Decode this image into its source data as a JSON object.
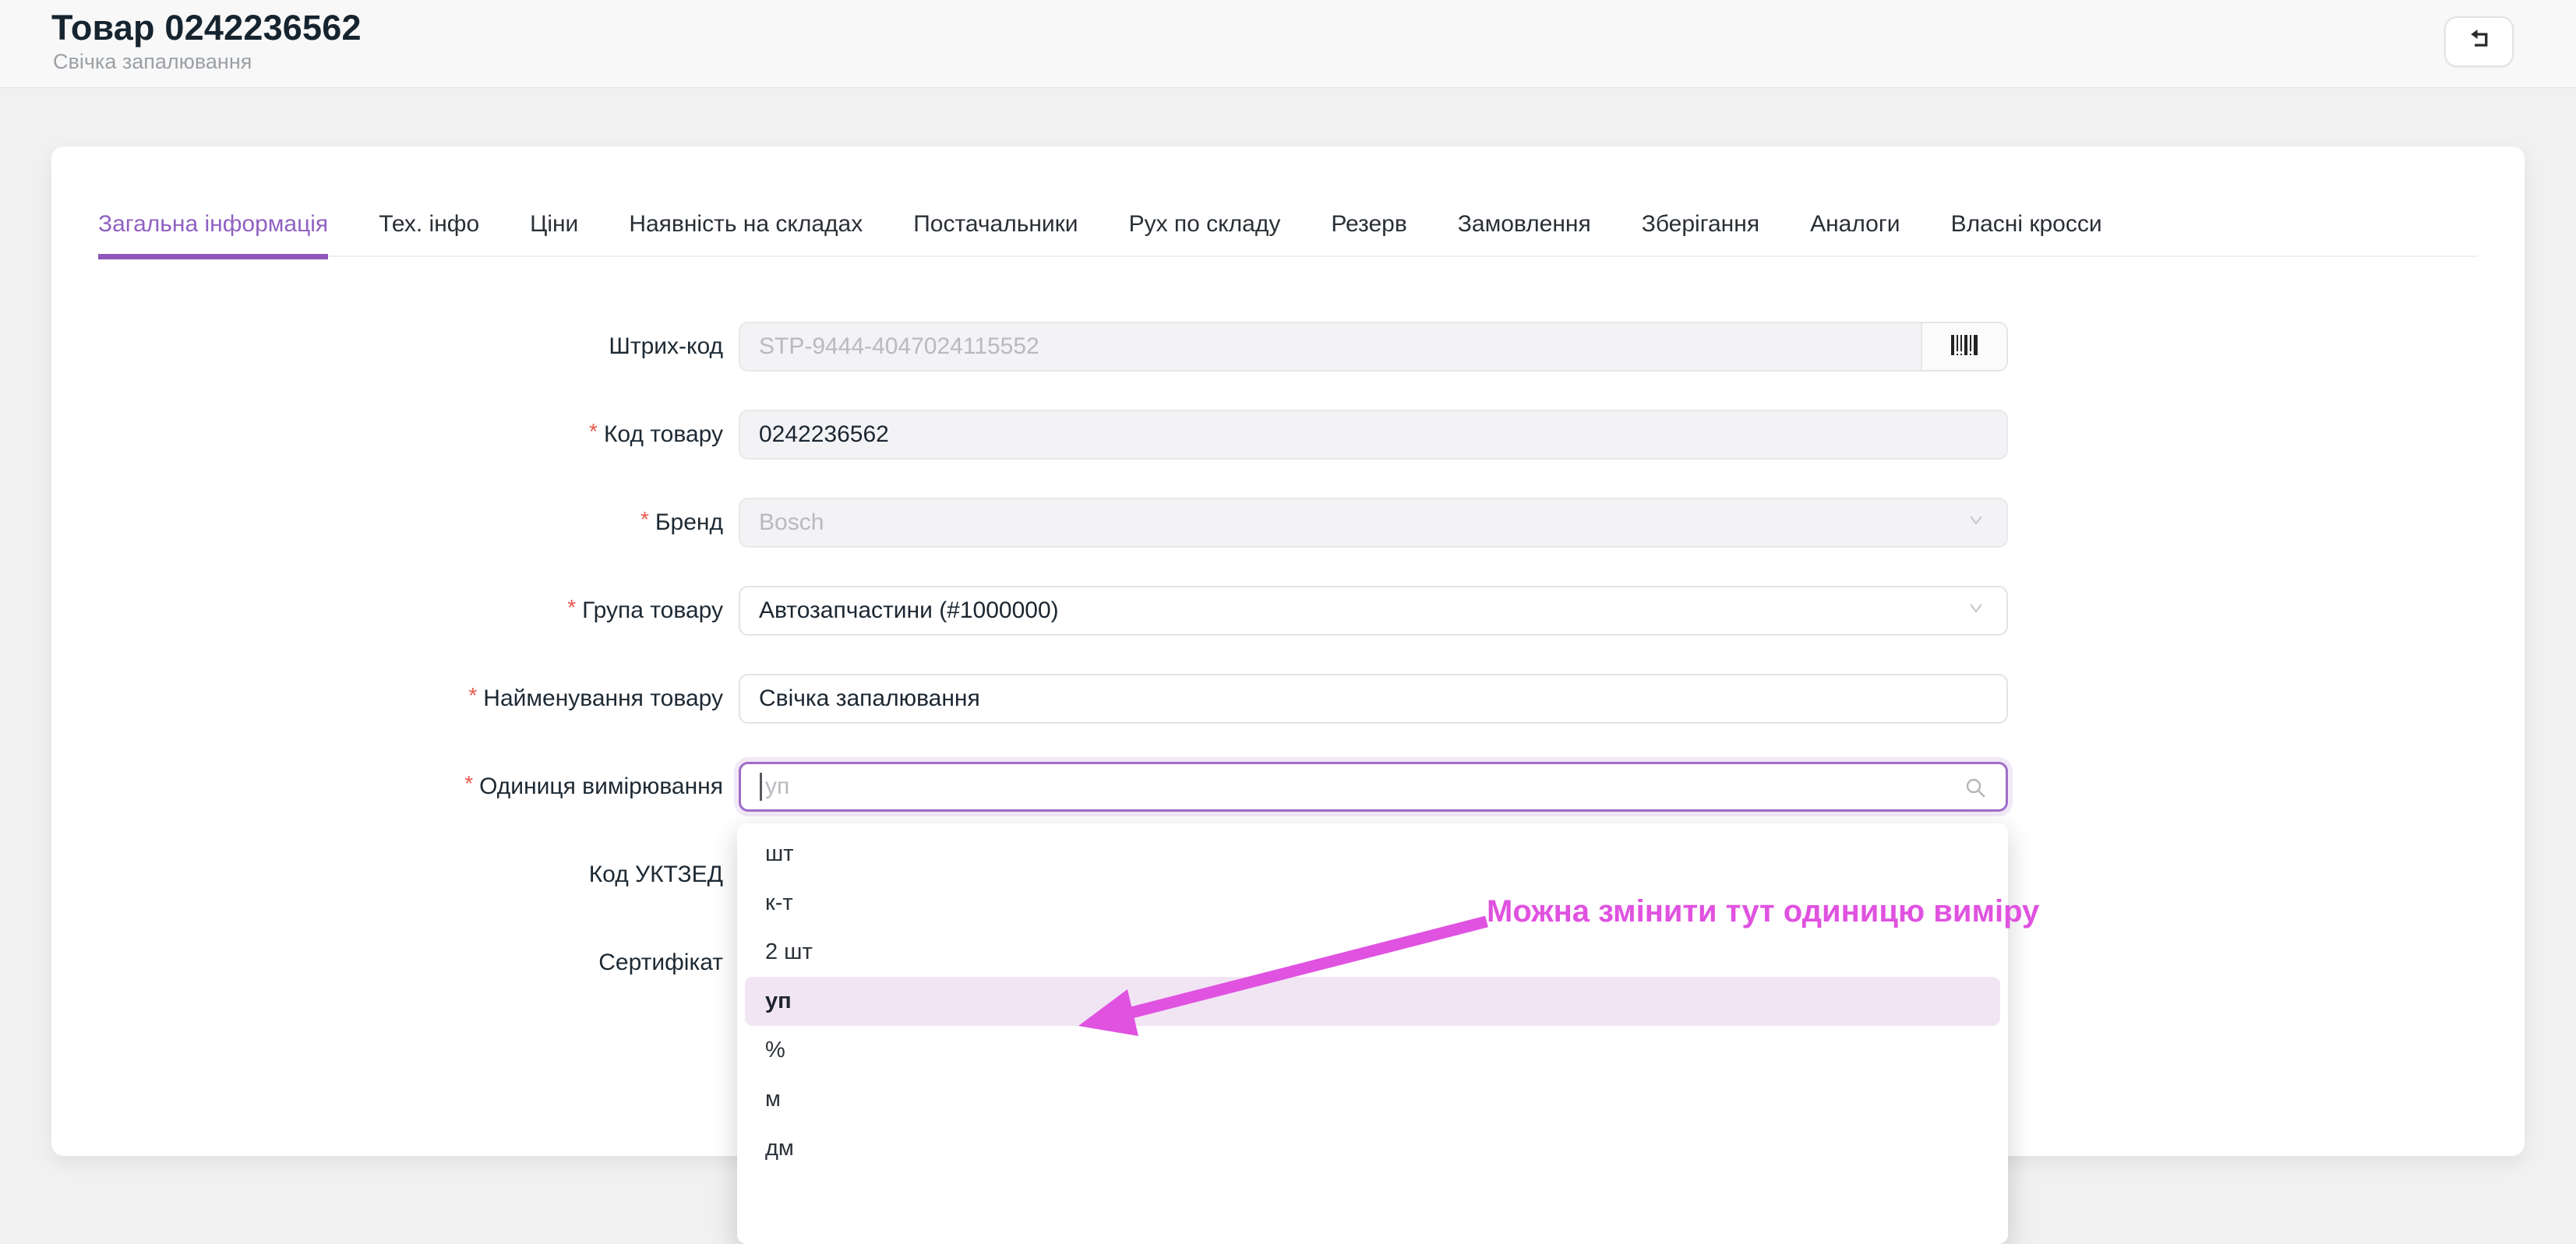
{
  "header": {
    "title": "Товар 0242236562",
    "subtitle": "Свічка запалювання"
  },
  "tabs": [
    {
      "label": "Загальна інформація",
      "active": true
    },
    {
      "label": "Тех. інфо"
    },
    {
      "label": "Ціни"
    },
    {
      "label": "Наявність на складах"
    },
    {
      "label": "Постачальники"
    },
    {
      "label": "Рух по складу"
    },
    {
      "label": "Резерв"
    },
    {
      "label": "Замовлення"
    },
    {
      "label": "Зберігання"
    },
    {
      "label": "Аналоги"
    },
    {
      "label": "Власні кросси"
    }
  ],
  "form": {
    "required_marker": "*",
    "barcode": {
      "label": "Штрих-код",
      "value": "",
      "placeholder": "STP-9444-4047024115552",
      "disabled": true
    },
    "product_code": {
      "label": "Код товару",
      "value": "0242236562",
      "required": true,
      "disabled": true
    },
    "brand": {
      "label": "Бренд",
      "value": "Bosch",
      "required": true,
      "disabled": true
    },
    "product_group": {
      "label": "Група товару",
      "value": "Автозапчастини (#1000000)",
      "required": true
    },
    "product_name": {
      "label": "Найменування товару",
      "value": "Свічка запалювання",
      "required": true
    },
    "unit": {
      "label": "Одиниця вимірювання",
      "value": "",
      "placeholder": "уп",
      "required": true,
      "focused": true
    },
    "uktzed": {
      "label": "Код УКТЗЕД"
    },
    "certificate": {
      "label": "Сертифікат"
    }
  },
  "unit_dropdown": {
    "options": [
      "шт",
      "к-т",
      "2 шт",
      "уп",
      "%",
      "м",
      "дм"
    ],
    "active_option": "уп"
  },
  "annotation": {
    "text": "Можна змінити тут одиницю виміру"
  },
  "colors": {
    "accent_purple": "#8e57b9",
    "focus_border": "#a06cc9",
    "annotation_magenta": "#e052e0",
    "active_option_bg": "#f1e5f4",
    "required_red": "#e8584b"
  }
}
